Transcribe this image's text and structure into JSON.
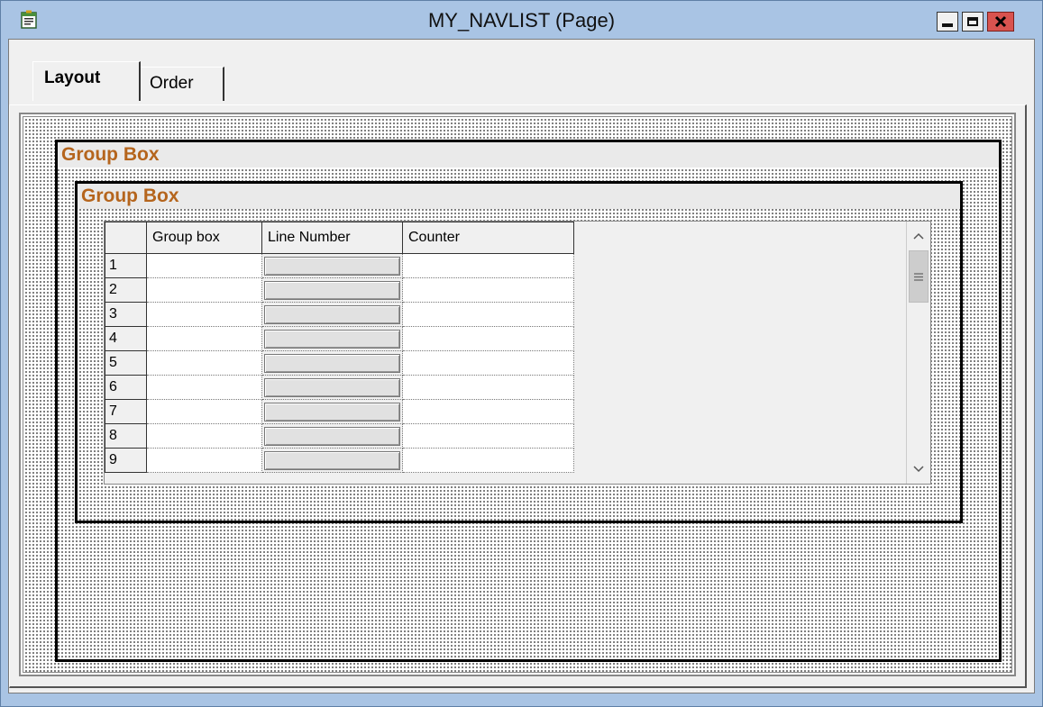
{
  "window": {
    "title": "MY_NAVLIST (Page)",
    "close_glyph": "✕"
  },
  "tabs": [
    {
      "label": "Layout",
      "active": true
    },
    {
      "label": "Order",
      "active": false
    }
  ],
  "outer_group_box": {
    "title": "Group Box"
  },
  "inner_group_box": {
    "title": "Group Box"
  },
  "grid": {
    "columns": [
      "Group box",
      "Line Number",
      "Counter"
    ],
    "rows": [
      "1",
      "2",
      "3",
      "4",
      "5",
      "6",
      "7",
      "8",
      "9"
    ]
  },
  "colors": {
    "title_bar": "#a9c4e4",
    "group_box_title": "#b5651d",
    "close_button": "#d9534f"
  },
  "icons": {
    "app": "page-icon",
    "scroll_up": "chevron-up-icon",
    "scroll_down": "chevron-down-icon",
    "scroll_thumb": "grip-icon"
  }
}
